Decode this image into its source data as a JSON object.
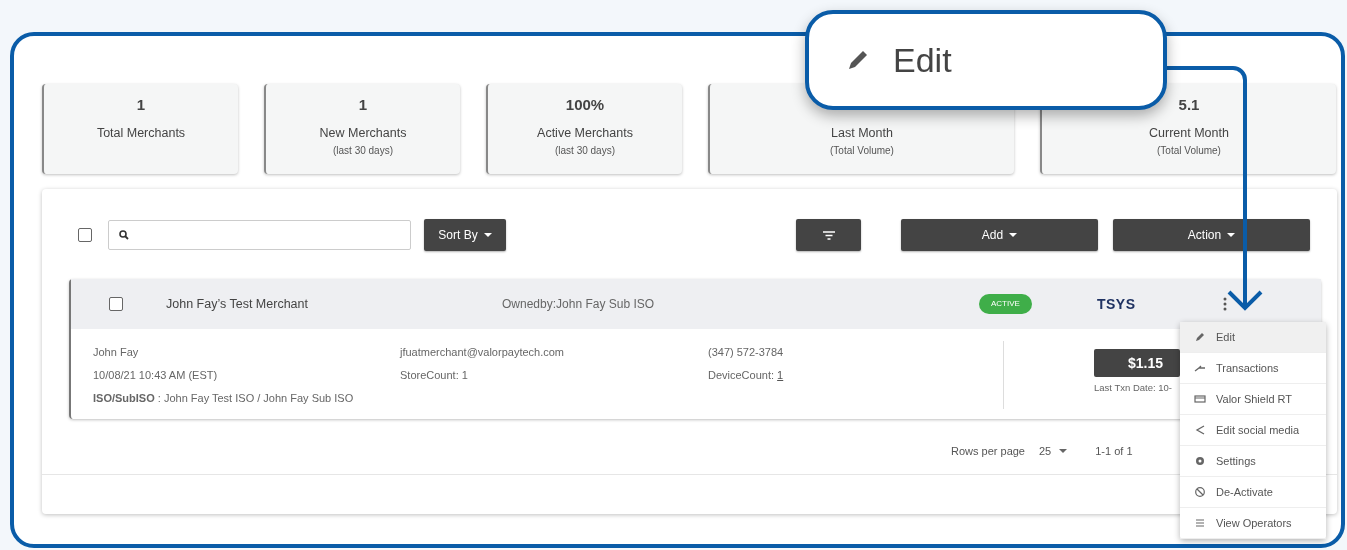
{
  "callout": {
    "label": "Edit"
  },
  "stats": [
    {
      "value": "1",
      "label": "Total Merchants"
    },
    {
      "value": "1",
      "label": "New Merchants",
      "sub": "(last 30 days)"
    },
    {
      "value": "100%",
      "label": "Active Merchants",
      "sub": "(last 30 days)"
    },
    {
      "label": "Last Month",
      "sub": "(Total Volume)"
    },
    {
      "value": "5.1",
      "label": "Current Month",
      "sub": "(Total Volume)"
    }
  ],
  "toolbar": {
    "select_all_checked": false,
    "sort_label": "Sort By",
    "add_label": "Add",
    "action_label": "Action"
  },
  "merchant": {
    "checked": false,
    "name": "John Fay’s Test Merchant",
    "owned_by": "Ownedby:John Fay Sub ISO",
    "status": "ACTIVE",
    "processor": "TSYS",
    "contact": "John Fay",
    "date": "10/08/21 10:43 AM (EST)",
    "iso": "**ISO/SubISO** : John Fay Test ISO / John Fay Sub ISO",
    "email": "jfuatmerchant@valorpaytech.com",
    "store_count": "StoreCount: 1",
    "phone": "(347) 572-3784",
    "device_label": "DeviceCount:",
    "device_count": "1",
    "amount": "$1.15",
    "last_txn": "Last Txn Date: 10-"
  },
  "pagination": {
    "rows_label": "Rows per page",
    "rows_value": "25",
    "range": "1-1 of 1"
  },
  "menu": [
    {
      "kind": "edit",
      "label": "Edit",
      "selected": true
    },
    {
      "kind": "transactions",
      "label": "Transactions",
      "selected": false
    },
    {
      "kind": "card",
      "label": "Valor Shield RT",
      "selected": false
    },
    {
      "kind": "share",
      "label": "Edit social media",
      "selected": false
    },
    {
      "kind": "settings",
      "label": "Settings",
      "selected": false
    },
    {
      "kind": "deactivate",
      "label": "De-Activate",
      "selected": false
    },
    {
      "kind": "list",
      "label": "View Operators",
      "selected": false
    }
  ]
}
